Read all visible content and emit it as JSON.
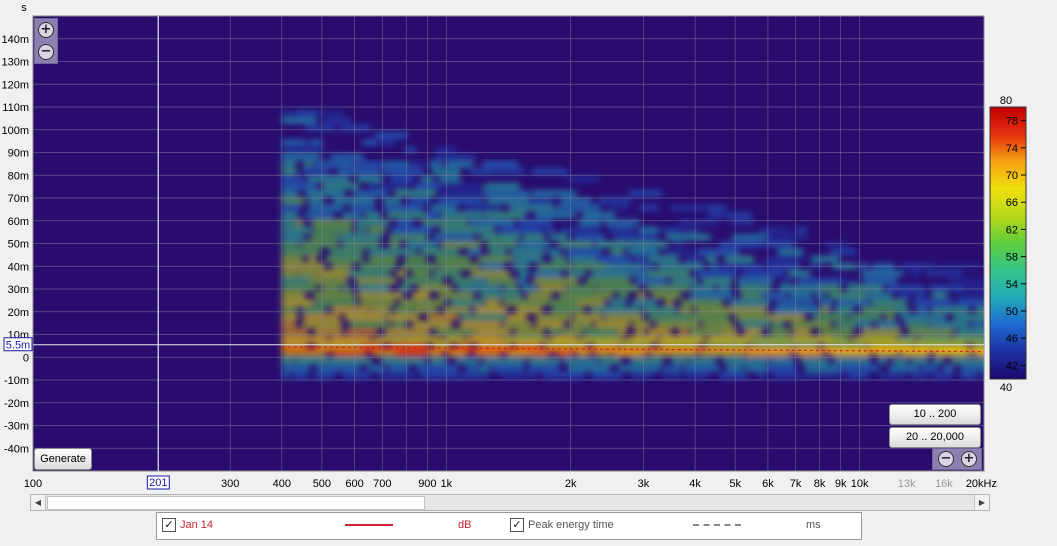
{
  "chart_data": {
    "type": "heatmap",
    "title": "",
    "xlabel": "",
    "ylabel": "s",
    "x_scale": "log",
    "xlim": [
      100,
      20000
    ],
    "ylim": [
      -0.05,
      0.15
    ],
    "x_ticks": [
      {
        "v": 100,
        "t": "100"
      },
      {
        "v": 300,
        "t": "300"
      },
      {
        "v": 400,
        "t": "400"
      },
      {
        "v": 500,
        "t": "500"
      },
      {
        "v": 600,
        "t": "600"
      },
      {
        "v": 700,
        "t": "700"
      },
      {
        "v": 900,
        "t": "900"
      },
      {
        "v": 1000,
        "t": "1k"
      },
      {
        "v": 2000,
        "t": "2k"
      },
      {
        "v": 3000,
        "t": "3k"
      },
      {
        "v": 4000,
        "t": "4k"
      },
      {
        "v": 5000,
        "t": "5k"
      },
      {
        "v": 6000,
        "t": "6k"
      },
      {
        "v": 7000,
        "t": "7k"
      },
      {
        "v": 8000,
        "t": "8k"
      },
      {
        "v": 9000,
        "t": "9k"
      },
      {
        "v": 10000,
        "t": "10k"
      },
      {
        "v": 13000,
        "t": "13k",
        "dim": true
      },
      {
        "v": 16000,
        "t": "16k",
        "dim": true
      },
      {
        "v": 20000,
        "t": "20kHz"
      }
    ],
    "x_gridlines": [
      200,
      300,
      400,
      500,
      600,
      700,
      800,
      900,
      1000,
      2000,
      3000,
      4000,
      5000,
      6000,
      7000,
      8000,
      9000,
      10000,
      20000
    ],
    "y_ticks": [
      {
        "v": 0.14,
        "t": "140m"
      },
      {
        "v": 0.13,
        "t": "130m"
      },
      {
        "v": 0.12,
        "t": "120m"
      },
      {
        "v": 0.11,
        "t": "110m"
      },
      {
        "v": 0.1,
        "t": "100m"
      },
      {
        "v": 0.09,
        "t": "90m"
      },
      {
        "v": 0.08,
        "t": "80m"
      },
      {
        "v": 0.07,
        "t": "70m"
      },
      {
        "v": 0.06,
        "t": "60m"
      },
      {
        "v": 0.05,
        "t": "50m"
      },
      {
        "v": 0.04,
        "t": "40m"
      },
      {
        "v": 0.03,
        "t": "30m"
      },
      {
        "v": 0.02,
        "t": "20m"
      },
      {
        "v": 0.01,
        "t": "10m"
      },
      {
        "v": 0.0,
        "t": "0"
      },
      {
        "v": -0.01,
        "t": "-10m"
      },
      {
        "v": -0.02,
        "t": "-20m"
      },
      {
        "v": -0.03,
        "t": "-30m"
      },
      {
        "v": -0.04,
        "t": "-40m"
      }
    ],
    "cursor": {
      "x": 201,
      "x_label": "201",
      "y": 0.0055,
      "y_label": "5.5m"
    },
    "colorbar": {
      "min": 40,
      "max": 80,
      "min_label": "40",
      "max_label": "80",
      "ticks": [
        42,
        46,
        50,
        54,
        58,
        62,
        66,
        70,
        74,
        78
      ],
      "colors": [
        "#1a0a6e",
        "#1f2fa0",
        "#1e6ad0",
        "#22aab8",
        "#35c48a",
        "#5fce3c",
        "#b8d818",
        "#f0e010",
        "#f4a010",
        "#e53010",
        "#c00000"
      ]
    },
    "data_start_hz": 400,
    "series": [
      {
        "name": "Jan 14",
        "values": [],
        "color": "#cc2233"
      },
      {
        "name": "Peak energy time",
        "values": [],
        "color": "#888888"
      }
    ],
    "legend_placement": "bottom",
    "grid": true
  },
  "controls": {
    "generate_label": "Generate",
    "range_btn_1": "10 .. 200",
    "range_btn_2": "20 .. 20,000",
    "zoom_in_icon": "zoom-in-icon",
    "zoom_out_icon": "zoom-out-icon"
  },
  "legend": {
    "item1_label": "Jan 14",
    "item1_unit": "dB",
    "item2_label": "Peak energy time",
    "item2_unit": "ms",
    "item1_color": "#cc2233",
    "item2_color": "#888888"
  }
}
